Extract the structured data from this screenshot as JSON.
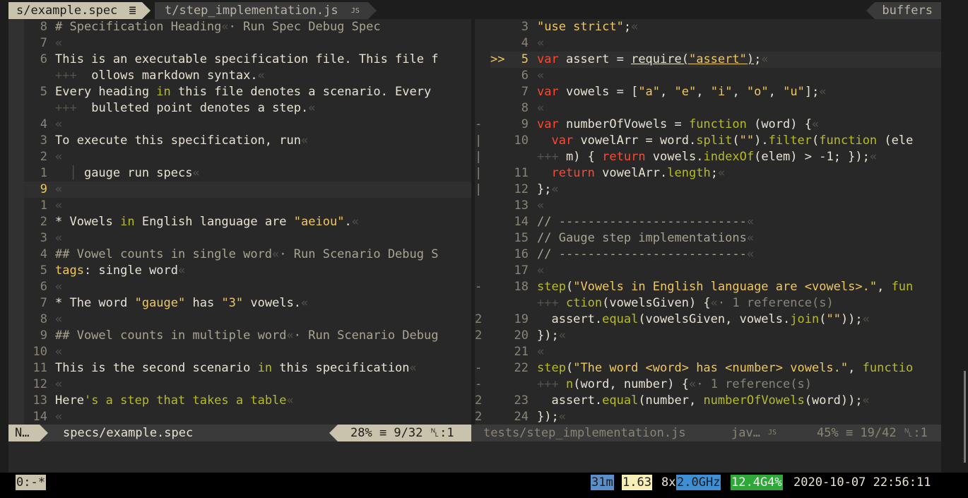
{
  "tabs": {
    "active": {
      "label": "s/example.spec",
      "icon": "≣"
    },
    "inactive": {
      "label": "t/step_implementation.js",
      "icon": "JS"
    },
    "buffers": "buffers"
  },
  "left": {
    "lines": [
      {
        "ln": "8",
        "segs": [
          [
            "# Specification Heading",
            "#a9a48f"
          ],
          [
            "«",
            "#55524a"
          ],
          [
            "· Run Spec Debug Spec",
            "#a9a48f"
          ]
        ]
      },
      {
        "ln": "7",
        "segs": [
          [
            "«",
            "#55524a"
          ]
        ]
      },
      {
        "ln": "6",
        "segs": [
          [
            "This is an executable specification file. This file f",
            "#e8e2d0"
          ]
        ]
      },
      {
        "ln": "",
        "wrap": true,
        "segs": [
          [
            "ollows markdown syntax.",
            "#e8e2d0"
          ],
          [
            "«",
            "#55524a"
          ]
        ]
      },
      {
        "ln": "5",
        "segs": [
          [
            "Every heading ",
            "#e8e2d0"
          ],
          [
            "in",
            "#b8bb26"
          ],
          [
            " this file denotes a scenario. Every",
            "#e8e2d0"
          ]
        ]
      },
      {
        "ln": "",
        "wrap": true,
        "segs": [
          [
            "bulleted point denotes a step.",
            "#e8e2d0"
          ],
          [
            "«",
            "#55524a"
          ]
        ]
      },
      {
        "ln": "4",
        "segs": [
          [
            "«",
            "#55524a"
          ]
        ]
      },
      {
        "ln": "3",
        "segs": [
          [
            "To execute this specification, run",
            "#e8e2d0"
          ],
          [
            "«",
            "#55524a"
          ]
        ]
      },
      {
        "ln": "2",
        "segs": [
          [
            "«",
            "#55524a"
          ]
        ]
      },
      {
        "ln": "1",
        "segs": [
          [
            "  │ ",
            "#55524a"
          ],
          [
            "gauge run specs",
            "#e8e2d0"
          ],
          [
            "«",
            "#55524a"
          ]
        ]
      },
      {
        "ln": "9",
        "cur": true,
        "segs": [
          [
            "«",
            "#55524a"
          ]
        ]
      },
      {
        "ln": "1",
        "segs": [
          [
            "«",
            "#55524a"
          ]
        ]
      },
      {
        "ln": "2",
        "segs": [
          [
            "* Vowels ",
            "#e8e2d0"
          ],
          [
            "in",
            "#b8bb26"
          ],
          [
            " English language are ",
            "#e8e2d0"
          ],
          [
            "\"aeiou\"",
            "#f0c75e"
          ],
          [
            ".",
            "#e8e2d0"
          ],
          [
            "«",
            "#55524a"
          ]
        ]
      },
      {
        "ln": "3",
        "segs": [
          [
            "«",
            "#55524a"
          ]
        ]
      },
      {
        "ln": "4",
        "segs": [
          [
            "## Vowel counts in single word",
            "#a9a48f"
          ],
          [
            "«",
            "#55524a"
          ],
          [
            "· Run Scenario Debug S",
            "#a9a48f"
          ]
        ]
      },
      {
        "ln": "5",
        "segs": [
          [
            "tags",
            "#f0c75e"
          ],
          [
            ": single word",
            "#e8e2d0"
          ],
          [
            "«",
            "#55524a"
          ]
        ]
      },
      {
        "ln": "6",
        "segs": [
          [
            "«",
            "#55524a"
          ]
        ]
      },
      {
        "ln": "7",
        "segs": [
          [
            "* The word ",
            "#e8e2d0"
          ],
          [
            "\"gauge\"",
            "#f0c75e"
          ],
          [
            " has ",
            "#e8e2d0"
          ],
          [
            "\"3\"",
            "#f0c75e"
          ],
          [
            " vowels.",
            "#e8e2d0"
          ],
          [
            "«",
            "#55524a"
          ]
        ]
      },
      {
        "ln": "8",
        "segs": [
          [
            "«",
            "#55524a"
          ]
        ]
      },
      {
        "ln": "9",
        "segs": [
          [
            "## Vowel counts in multiple word",
            "#a9a48f"
          ],
          [
            "«",
            "#55524a"
          ],
          [
            "· Run Scenario Debug",
            "#a9a48f"
          ]
        ]
      },
      {
        "ln": "10",
        "segs": [
          [
            "«",
            "#55524a"
          ]
        ]
      },
      {
        "ln": "11",
        "segs": [
          [
            "This is the second scenario ",
            "#e8e2d0"
          ],
          [
            "in",
            "#b8bb26"
          ],
          [
            " this specification",
            "#e8e2d0"
          ],
          [
            "«",
            "#55524a"
          ]
        ]
      },
      {
        "ln": "12",
        "segs": [
          [
            "«",
            "#55524a"
          ]
        ]
      },
      {
        "ln": "13",
        "segs": [
          [
            "Here",
            "#e8e2d0"
          ],
          [
            "'s a step that takes a table",
            "#b8bb26"
          ],
          [
            "«",
            "#55524a"
          ]
        ]
      },
      {
        "ln": "14",
        "segs": [
          [
            "«",
            "#55524a"
          ]
        ]
      }
    ]
  },
  "right": {
    "lines": [
      {
        "sign": "",
        "ln": "3",
        "segs": [
          [
            "\"use strict\"",
            "#f0c75e"
          ],
          [
            ";",
            "#e8e2d0"
          ],
          [
            "«",
            "#55524a"
          ]
        ]
      },
      {
        "sign": "",
        "ln": "4",
        "segs": [
          [
            "«",
            "#55524a"
          ]
        ]
      },
      {
        "sign": ">>",
        "ln": "5",
        "cur": true,
        "segs": [
          [
            "var",
            "#fb4934"
          ],
          [
            " assert = ",
            "#e8e2d0"
          ],
          [
            "require(",
            "#e8e2d0",
            "u"
          ],
          [
            "\"assert\"",
            "#f0c75e",
            "u"
          ],
          [
            ")",
            "#e8e2d0",
            "u"
          ],
          [
            ";",
            "#e8e2d0"
          ],
          [
            "«",
            "#55524a"
          ]
        ]
      },
      {
        "sign": "",
        "ln": "6",
        "segs": [
          [
            "«",
            "#55524a"
          ]
        ]
      },
      {
        "sign": "",
        "ln": "7",
        "segs": [
          [
            "var",
            "#fb4934"
          ],
          [
            " vowels = [",
            "#e8e2d0"
          ],
          [
            "\"a\"",
            "#f0c75e"
          ],
          [
            ", ",
            "#e8e2d0"
          ],
          [
            "\"e\"",
            "#f0c75e"
          ],
          [
            ", ",
            "#e8e2d0"
          ],
          [
            "\"i\"",
            "#f0c75e"
          ],
          [
            ", ",
            "#e8e2d0"
          ],
          [
            "\"o\"",
            "#f0c75e"
          ],
          [
            ", ",
            "#e8e2d0"
          ],
          [
            "\"u\"",
            "#f0c75e"
          ],
          [
            "];",
            "#e8e2d0"
          ],
          [
            "«",
            "#55524a"
          ]
        ]
      },
      {
        "sign": "",
        "ln": "8",
        "segs": [
          [
            "«",
            "#55524a"
          ]
        ]
      },
      {
        "sign": "-",
        "ln": "9",
        "segs": [
          [
            "var",
            "#fb4934"
          ],
          [
            " numberOfVowels = ",
            "#e8e2d0"
          ],
          [
            "function",
            "#b8bb26"
          ],
          [
            " (word) {",
            "#e8e2d0"
          ],
          [
            "«",
            "#55524a"
          ]
        ]
      },
      {
        "sign": "|",
        "ln": "10",
        "segs": [
          [
            "  ",
            "#e8e2d0"
          ],
          [
            "var",
            "#fb4934"
          ],
          [
            " vowelArr = word.",
            "#e8e2d0"
          ],
          [
            "split",
            "#b8bb26"
          ],
          [
            "(",
            "#e8e2d0"
          ],
          [
            "\"\"",
            "#f0c75e"
          ],
          [
            ").",
            "#e8e2d0"
          ],
          [
            "filter",
            "#b8bb26"
          ],
          [
            "(",
            "#e8e2d0"
          ],
          [
            "function",
            "#b8bb26"
          ],
          [
            " (ele",
            "#e8e2d0"
          ]
        ]
      },
      {
        "sign": "|",
        "ln": "",
        "wrap": true,
        "segs": [
          [
            "m) { ",
            "#e8e2d0"
          ],
          [
            "return",
            "#fb4934"
          ],
          [
            " vowels.",
            "#e8e2d0"
          ],
          [
            "indexOf",
            "#b8bb26"
          ],
          [
            "(elem) > -1; });",
            "#e8e2d0"
          ],
          [
            "«",
            "#55524a"
          ]
        ]
      },
      {
        "sign": "|",
        "ln": "11",
        "segs": [
          [
            "  ",
            "#e8e2d0"
          ],
          [
            "return",
            "#fb4934"
          ],
          [
            " vowelArr.",
            "#e8e2d0"
          ],
          [
            "length",
            "#b8bb26"
          ],
          [
            ";",
            "#e8e2d0"
          ],
          [
            "«",
            "#55524a"
          ]
        ]
      },
      {
        "sign": "|",
        "ln": "12",
        "segs": [
          [
            "};",
            "#e8e2d0"
          ],
          [
            "«",
            "#55524a"
          ]
        ]
      },
      {
        "sign": "",
        "ln": "13",
        "segs": [
          [
            "«",
            "#55524a"
          ]
        ]
      },
      {
        "sign": "",
        "ln": "14",
        "segs": [
          [
            "// --------------------------",
            "#a9a48f"
          ],
          [
            "«",
            "#55524a"
          ]
        ]
      },
      {
        "sign": "",
        "ln": "15",
        "segs": [
          [
            "// Gauge step implementations",
            "#a9a48f"
          ],
          [
            "«",
            "#55524a"
          ]
        ]
      },
      {
        "sign": "",
        "ln": "16",
        "segs": [
          [
            "// --------------------------",
            "#a9a48f"
          ],
          [
            "«",
            "#55524a"
          ]
        ]
      },
      {
        "sign": "",
        "ln": "17",
        "segs": [
          [
            "«",
            "#55524a"
          ]
        ]
      },
      {
        "sign": "-",
        "ln": "18",
        "segs": [
          [
            "step",
            "#b8bb26"
          ],
          [
            "(",
            "#e8e2d0"
          ],
          [
            "\"Vowels in English language are <vowels>.\"",
            "#f0c75e"
          ],
          [
            ", ",
            "#e8e2d0"
          ],
          [
            "fun",
            "#b8bb26"
          ]
        ]
      },
      {
        "sign": "",
        "ln": "",
        "wrap": true,
        "segs": [
          [
            "ction",
            "#b8bb26"
          ],
          [
            "(vowelsGiven) {",
            "#e8e2d0"
          ],
          [
            "«",
            "#55524a"
          ],
          [
            "· 1 reference(s)",
            "#8a8573"
          ]
        ]
      },
      {
        "sign": "2",
        "ln": "19",
        "segs": [
          [
            "  assert.",
            "#e8e2d0"
          ],
          [
            "equal",
            "#b8bb26"
          ],
          [
            "(vowelsGiven, vowels.",
            "#e8e2d0"
          ],
          [
            "join",
            "#b8bb26"
          ],
          [
            "(",
            "#e8e2d0"
          ],
          [
            "\"\"",
            "#f0c75e"
          ],
          [
            "));",
            "#e8e2d0"
          ],
          [
            "«",
            "#55524a"
          ]
        ]
      },
      {
        "sign": "2",
        "ln": "20",
        "segs": [
          [
            "});",
            "#e8e2d0"
          ],
          [
            "«",
            "#55524a"
          ]
        ]
      },
      {
        "sign": "",
        "ln": "21",
        "segs": [
          [
            "«",
            "#55524a"
          ]
        ]
      },
      {
        "sign": "-",
        "ln": "22",
        "segs": [
          [
            "step",
            "#b8bb26"
          ],
          [
            "(",
            "#e8e2d0"
          ],
          [
            "\"The word <word> has <number> vowels.\"",
            "#f0c75e"
          ],
          [
            ", ",
            "#e8e2d0"
          ],
          [
            "functio",
            "#b8bb26"
          ]
        ]
      },
      {
        "sign": "-",
        "ln": "",
        "wrap": true,
        "segs": [
          [
            "n",
            "#b8bb26"
          ],
          [
            "(word, number) {",
            "#e8e2d0"
          ],
          [
            "«",
            "#55524a"
          ],
          [
            "· 1 reference(s)",
            "#8a8573"
          ]
        ]
      },
      {
        "sign": "2",
        "ln": "23",
        "segs": [
          [
            "  assert.",
            "#e8e2d0"
          ],
          [
            "equal",
            "#b8bb26"
          ],
          [
            "(number, ",
            "#e8e2d0"
          ],
          [
            "numberOfVowels",
            "#b8bb26"
          ],
          [
            "(word));",
            "#e8e2d0"
          ],
          [
            "«",
            "#55524a"
          ]
        ]
      },
      {
        "sign": "2",
        "ln": "24",
        "segs": [
          [
            "});",
            "#e8e2d0"
          ],
          [
            "«",
            "#55524a"
          ]
        ]
      }
    ]
  },
  "wrap_marker": "+++",
  "statusbar": {
    "mode": "N…",
    "left_file": "specs/example.spec",
    "left_pos": "28% ≡ 9/32 ␤:1",
    "right_file": "tests/step_implementation.js",
    "right_type": "jav…",
    "right_type_icon": "JS",
    "right_pos": "45% ≡ 19/42 ␤:1"
  },
  "tmux": {
    "session": "0:-*",
    "uptime": "31m",
    "load": "1.63",
    "cpu_count": "8x",
    "cpu_freq": "2.0GHz",
    "mem": "12.4G4%",
    "datetime": "2020-10-07 22:56:11"
  },
  "colors": {
    "accent_yellow": "#f0c75e",
    "keyword_red": "#fb4934",
    "function_green": "#b8bb26",
    "uptime_bg": "#5b8fc9",
    "load_bg": "#f6efb6",
    "freq_bg": "#3e8fd6",
    "mem_bg": "#2fa83a"
  }
}
